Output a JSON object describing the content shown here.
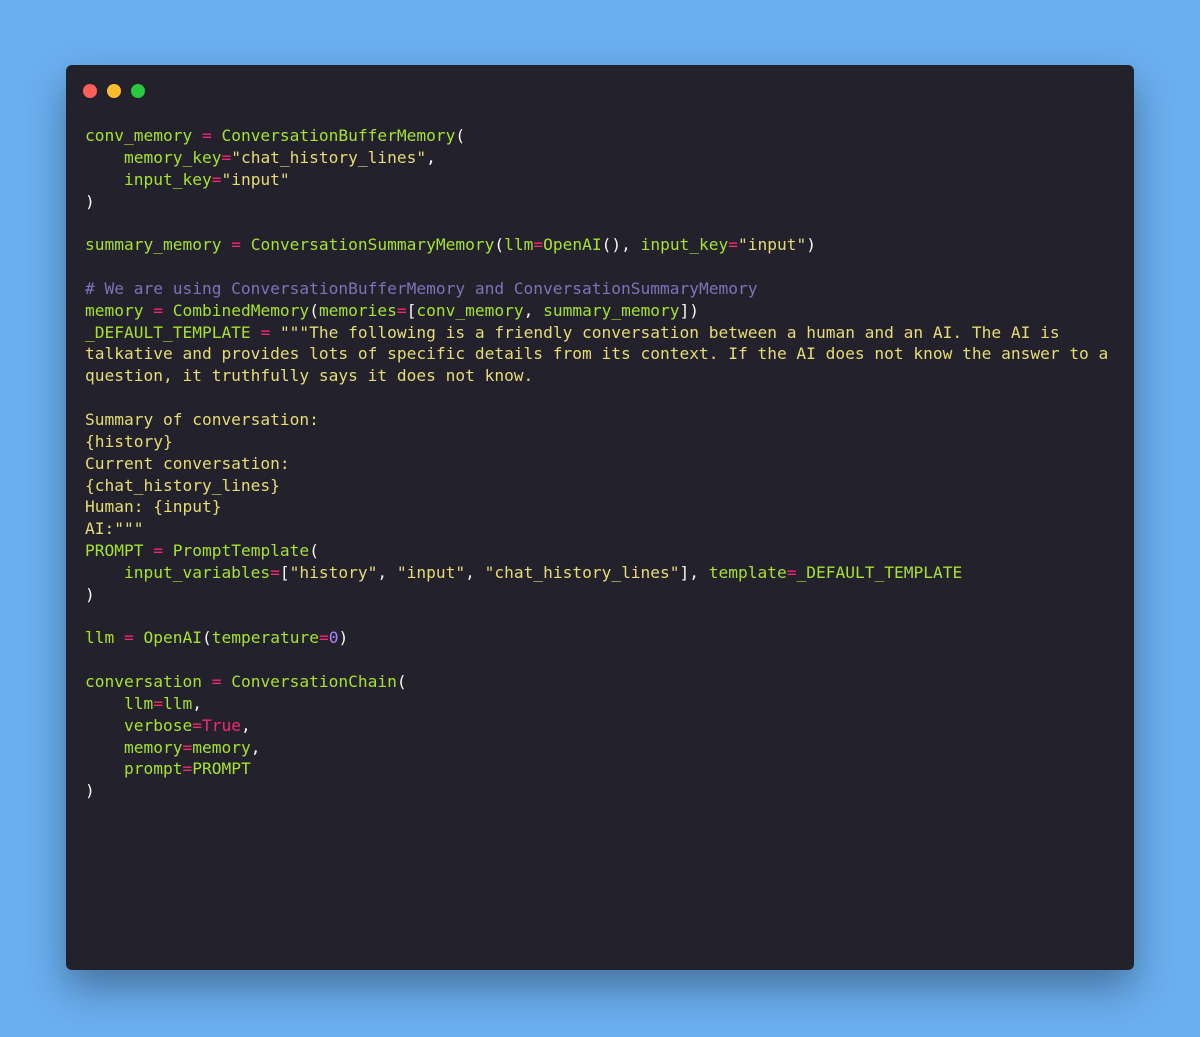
{
  "window": {
    "controls": [
      {
        "name": "close",
        "color": "#ff5f56"
      },
      {
        "name": "minimize",
        "color": "#ffbd2e"
      },
      {
        "name": "maximize",
        "color": "#27c93f"
      }
    ]
  },
  "colors": {
    "background": "#6aaff0",
    "editor": "#23222c",
    "identifier": "#a6e22e",
    "operator": "#f92672",
    "string": "#e6db74",
    "comment": "#7e72b8",
    "number": "#ae81ff",
    "punctuation": "#f8f8f2"
  },
  "code": {
    "lines": [
      [
        [
          "n",
          "conv_memory"
        ],
        [
          "p",
          " "
        ],
        [
          "o",
          "="
        ],
        [
          "p",
          " "
        ],
        [
          "n",
          "ConversationBufferMemory"
        ],
        [
          "p",
          "("
        ]
      ],
      [
        [
          "p",
          "    "
        ],
        [
          "n",
          "memory_key"
        ],
        [
          "o",
          "="
        ],
        [
          "s",
          "\"chat_history_lines\""
        ],
        [
          "p",
          ","
        ]
      ],
      [
        [
          "p",
          "    "
        ],
        [
          "n",
          "input_key"
        ],
        [
          "o",
          "="
        ],
        [
          "s",
          "\"input\""
        ]
      ],
      [
        [
          "p",
          ")"
        ]
      ],
      [],
      [
        [
          "n",
          "summary_memory"
        ],
        [
          "p",
          " "
        ],
        [
          "o",
          "="
        ],
        [
          "p",
          " "
        ],
        [
          "n",
          "ConversationSummaryMemory"
        ],
        [
          "p",
          "("
        ],
        [
          "n",
          "llm"
        ],
        [
          "o",
          "="
        ],
        [
          "n",
          "OpenAI"
        ],
        [
          "p",
          "(), "
        ],
        [
          "n",
          "input_key"
        ],
        [
          "o",
          "="
        ],
        [
          "s",
          "\"input\""
        ],
        [
          "p",
          ")"
        ]
      ],
      [],
      [
        [
          "c",
          "# We are using ConversationBufferMemory and ConversationSummaryMemory"
        ]
      ],
      [
        [
          "n",
          "memory"
        ],
        [
          "p",
          " "
        ],
        [
          "o",
          "="
        ],
        [
          "p",
          " "
        ],
        [
          "n",
          "CombinedMemory"
        ],
        [
          "p",
          "("
        ],
        [
          "n",
          "memories"
        ],
        [
          "o",
          "="
        ],
        [
          "p",
          "["
        ],
        [
          "n",
          "conv_memory"
        ],
        [
          "p",
          ", "
        ],
        [
          "n",
          "summary_memory"
        ],
        [
          "p",
          "])"
        ]
      ],
      [
        [
          "n",
          "_DEFAULT_TEMPLATE"
        ],
        [
          "p",
          " "
        ],
        [
          "o",
          "="
        ],
        [
          "p",
          " "
        ],
        [
          "s",
          "\"\"\"The following is a friendly conversation between a human and an AI. The AI is"
        ]
      ],
      [
        [
          "s",
          "talkative and provides lots of specific details from its context. If the AI does not know the answer to a"
        ]
      ],
      [
        [
          "s",
          "question, it truthfully says it does not know."
        ]
      ],
      [],
      [
        [
          "s",
          "Summary of conversation:"
        ]
      ],
      [
        [
          "s",
          "{history}"
        ]
      ],
      [
        [
          "s",
          "Current conversation:"
        ]
      ],
      [
        [
          "s",
          "{chat_history_lines}"
        ]
      ],
      [
        [
          "s",
          "Human: {input}"
        ]
      ],
      [
        [
          "s",
          "AI:\"\"\""
        ]
      ],
      [
        [
          "n",
          "PROMPT"
        ],
        [
          "p",
          " "
        ],
        [
          "o",
          "="
        ],
        [
          "p",
          " "
        ],
        [
          "n",
          "PromptTemplate"
        ],
        [
          "p",
          "("
        ]
      ],
      [
        [
          "p",
          "    "
        ],
        [
          "n",
          "input_variables"
        ],
        [
          "o",
          "="
        ],
        [
          "p",
          "["
        ],
        [
          "s",
          "\"history\""
        ],
        [
          "p",
          ", "
        ],
        [
          "s",
          "\"input\""
        ],
        [
          "p",
          ", "
        ],
        [
          "s",
          "\"chat_history_lines\""
        ],
        [
          "p",
          "], "
        ],
        [
          "n",
          "template"
        ],
        [
          "o",
          "="
        ],
        [
          "n",
          "_DEFAULT_TEMPLATE"
        ]
      ],
      [
        [
          "p",
          ")"
        ]
      ],
      [],
      [
        [
          "n",
          "llm"
        ],
        [
          "p",
          " "
        ],
        [
          "o",
          "="
        ],
        [
          "p",
          " "
        ],
        [
          "n",
          "OpenAI"
        ],
        [
          "p",
          "("
        ],
        [
          "n",
          "temperature"
        ],
        [
          "o",
          "="
        ],
        [
          "m",
          "0"
        ],
        [
          "p",
          ")"
        ]
      ],
      [],
      [
        [
          "n",
          "conversation"
        ],
        [
          "p",
          " "
        ],
        [
          "o",
          "="
        ],
        [
          "p",
          " "
        ],
        [
          "n",
          "ConversationChain"
        ],
        [
          "p",
          "("
        ]
      ],
      [
        [
          "p",
          "    "
        ],
        [
          "n",
          "llm"
        ],
        [
          "o",
          "="
        ],
        [
          "n",
          "llm"
        ],
        [
          "p",
          ","
        ]
      ],
      [
        [
          "p",
          "    "
        ],
        [
          "n",
          "verbose"
        ],
        [
          "o",
          "="
        ],
        [
          "k",
          "True"
        ],
        [
          "p",
          ","
        ]
      ],
      [
        [
          "p",
          "    "
        ],
        [
          "n",
          "memory"
        ],
        [
          "o",
          "="
        ],
        [
          "n",
          "memory"
        ],
        [
          "p",
          ","
        ]
      ],
      [
        [
          "p",
          "    "
        ],
        [
          "n",
          "prompt"
        ],
        [
          "o",
          "="
        ],
        [
          "n",
          "PROMPT"
        ]
      ],
      [
        [
          "p",
          ")"
        ]
      ]
    ]
  }
}
